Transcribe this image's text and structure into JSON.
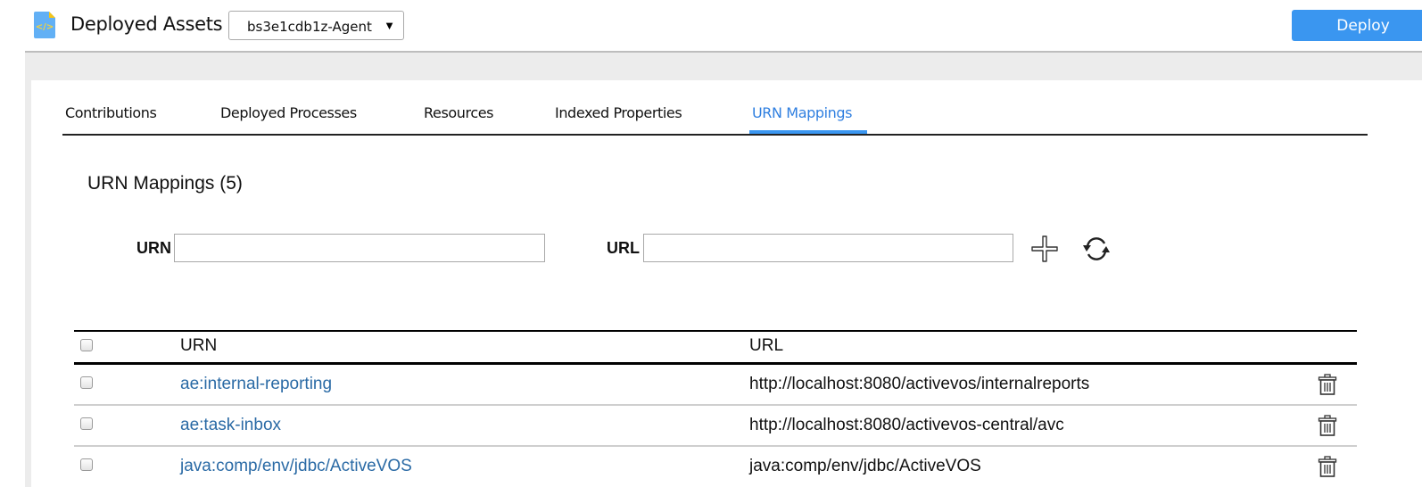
{
  "header": {
    "app_icon": "code-file-icon",
    "title": "Deployed Assets",
    "agent_select": {
      "value": "bs3e1cdb1z-Agent",
      "arrow": "▼"
    },
    "deploy_label": "Deploy"
  },
  "tabs": [
    {
      "label": "Contributions",
      "active": false
    },
    {
      "label": "Deployed Processes",
      "active": false
    },
    {
      "label": "Resources",
      "active": false
    },
    {
      "label": "Indexed Properties",
      "active": false
    },
    {
      "label": "URN Mappings",
      "active": true
    }
  ],
  "section": {
    "title": "URN Mappings (5)",
    "urn_label": "URN",
    "urn_value": "",
    "url_label": "URL",
    "url_value": "",
    "add_icon": "plus-icon",
    "refresh_icon": "refresh-icon"
  },
  "table": {
    "columns": [
      "URN",
      "URL"
    ],
    "rows": [
      {
        "urn": "ae:internal-reporting",
        "url": "http://localhost:8080/activevos/internalreports",
        "checked": false
      },
      {
        "urn": "ae:task-inbox",
        "url": "http://localhost:8080/activevos-central/avc",
        "checked": false
      },
      {
        "urn": "java:comp/env/jdbc/ActiveVOS",
        "url": "java:comp/env/jdbc/ActiveVOS",
        "checked": false
      }
    ]
  },
  "colors": {
    "accent": "#3a96f0",
    "active_tab": "#2f7fe0",
    "link": "#2a6aa5",
    "background_bar": "#ececec"
  }
}
